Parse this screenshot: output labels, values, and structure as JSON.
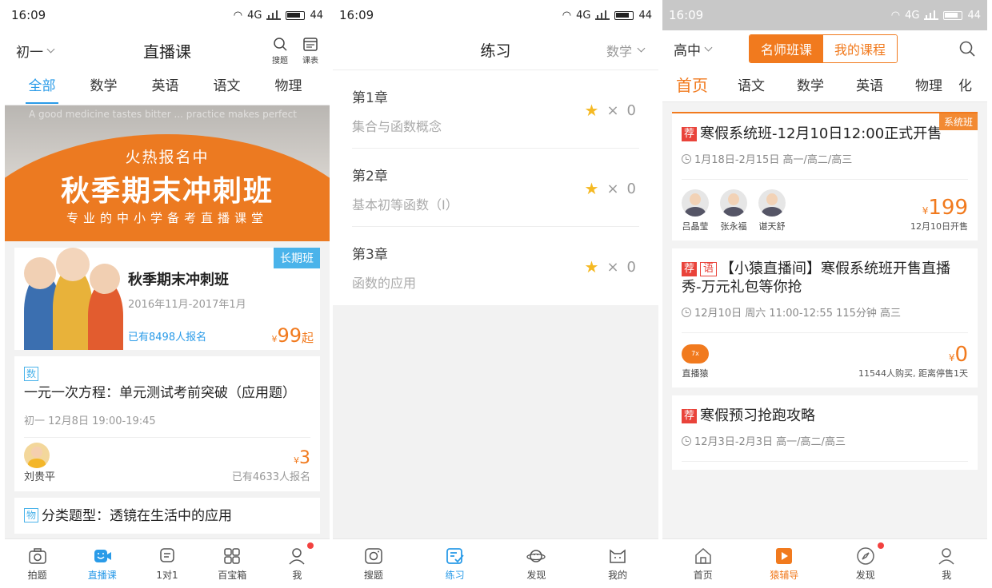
{
  "screen1": {
    "status": {
      "time": "16:09",
      "battery": "44",
      "net": "4G"
    },
    "header": {
      "grade": "初一",
      "title": "直播课",
      "search_label": "搜题",
      "schedule_label": "课表"
    },
    "tabs": [
      "全部",
      "数学",
      "英语",
      "语文",
      "物理"
    ],
    "banner": {
      "ghost_text": "A good medicine tastes bitter ... practice makes perfect",
      "line1": "火热报名中",
      "line2": "秋季期末冲刺班",
      "line3": "专业的中小学备考直播课堂"
    },
    "promo": {
      "tag": "长期班",
      "title": "秋季期末冲刺班",
      "date": "2016年11月-2017年1月",
      "enrolled": "已有8498人报名",
      "currency": "¥",
      "price": "99",
      "price_suffix": "起"
    },
    "lessons": [
      {
        "subject": "数",
        "title": "一元一次方程：单元测试考前突破（应用题）",
        "meta": "初一   12月8日 19:00-19:45",
        "teacher": "刘贵平",
        "currency": "¥",
        "price": "3",
        "enrolled": "已有4633人报名"
      },
      {
        "subject": "物",
        "title": "分类题型：透镜在生活中的应用"
      }
    ],
    "nav": [
      {
        "label": "拍题",
        "icon": "camera-icon"
      },
      {
        "label": "直播课",
        "icon": "live-tv-icon"
      },
      {
        "label": "1对1",
        "icon": "chat-icon"
      },
      {
        "label": "百宝箱",
        "icon": "grid-icon"
      },
      {
        "label": "我",
        "icon": "profile-icon"
      }
    ]
  },
  "screen2": {
    "status": {
      "time": "16:09",
      "battery": "44",
      "net": "4G"
    },
    "header": {
      "title": "练习",
      "subject": "数学"
    },
    "chapters": [
      {
        "name": "第1章",
        "topic": "集合与函数概念",
        "count": "0"
      },
      {
        "name": "第2章",
        "topic": "基本初等函数（I）",
        "count": "0"
      },
      {
        "name": "第3章",
        "topic": "函数的应用",
        "count": "0"
      }
    ],
    "multiply": "×",
    "nav": [
      {
        "label": "搜题",
        "icon": "camera-icon"
      },
      {
        "label": "练习",
        "icon": "practice-icon"
      },
      {
        "label": "发现",
        "icon": "planet-icon"
      },
      {
        "label": "我的",
        "icon": "cat-face-icon"
      }
    ]
  },
  "screen3": {
    "status": {
      "time": "16:09",
      "battery": "44",
      "net": "4G"
    },
    "header": {
      "grade": "高中",
      "seg_on": "名师班课",
      "seg_off": "我的课程"
    },
    "tabs": [
      "首页",
      "语文",
      "数学",
      "英语",
      "物理",
      "化"
    ],
    "courses": [
      {
        "tag": "系统班",
        "badges": [
          "荐"
        ],
        "title": "寒假系统班-12月10日12:00正式开售",
        "meta": "1月18日-2月15日 高一/高二/高三",
        "teachers": [
          "吕晶莹",
          "张永福",
          "谌天舒"
        ],
        "currency": "¥",
        "price": "199",
        "note": "12月10日开售"
      },
      {
        "badges": [
          "荐",
          "语"
        ],
        "title": "【小猿直播间】寒假系统班开售直播秀-万元礼包等你抢",
        "meta": "12月10日 周六 11:00-12:55 115分钟 高三",
        "teachers": [
          "直播猿"
        ],
        "logo_text": "7x",
        "currency": "¥",
        "price": "0",
        "note": "11544人购买, 距离停售1天"
      },
      {
        "badges": [
          "荐"
        ],
        "title": "寒假预习抢跑攻略",
        "meta": "12月3日-2月3日 高一/高二/高三"
      }
    ],
    "nav": [
      {
        "label": "首页",
        "icon": "home-icon"
      },
      {
        "label": "猿辅导",
        "icon": "play-icon"
      },
      {
        "label": "发现",
        "icon": "compass-icon"
      },
      {
        "label": "我",
        "icon": "profile-icon"
      }
    ]
  },
  "colors": {
    "blue": "#2a9be8",
    "orange": "#f17a1e",
    "red": "#e9433a",
    "star": "#f5b923"
  }
}
